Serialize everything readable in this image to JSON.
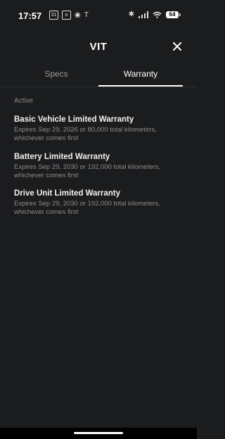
{
  "status_bar": {
    "time": "17:57",
    "left_icons": [
      "calendar-icon",
      "outlook-icon",
      "chrome-icon",
      "tesla-icon"
    ],
    "right_icons": [
      "bluetooth-icon",
      "signal-icon",
      "wifi-icon"
    ],
    "battery_level": "64"
  },
  "header": {
    "title": "VIT",
    "close_icon": "close-icon"
  },
  "tabs": [
    {
      "label": "Specs",
      "active": false
    },
    {
      "label": "Warranty",
      "active": true
    }
  ],
  "section": {
    "label": "Active"
  },
  "warranties": [
    {
      "title": "Basic Vehicle Limited Warranty",
      "desc_line1": "Expires Sep 29, 2026 or 80,000 total kilometers,",
      "desc_line2": "whichever comes first"
    },
    {
      "title": "Battery Limited Warranty",
      "desc_line1": "Expires Sep 29, 2030 or 192,000 total kilometers,",
      "desc_line2": "whichever comes first"
    },
    {
      "title": "Drive Unit Limited Warranty",
      "desc_line1": "Expires Sep 29, 2030 or 192,000 total kilometers,",
      "desc_line2": "whichever comes first"
    }
  ],
  "colors": {
    "background": "#1b1c1e",
    "active_tab": "#ffffff",
    "inactive_tab": "#9a9a9a",
    "secondary_text": "#8c8c8c"
  }
}
